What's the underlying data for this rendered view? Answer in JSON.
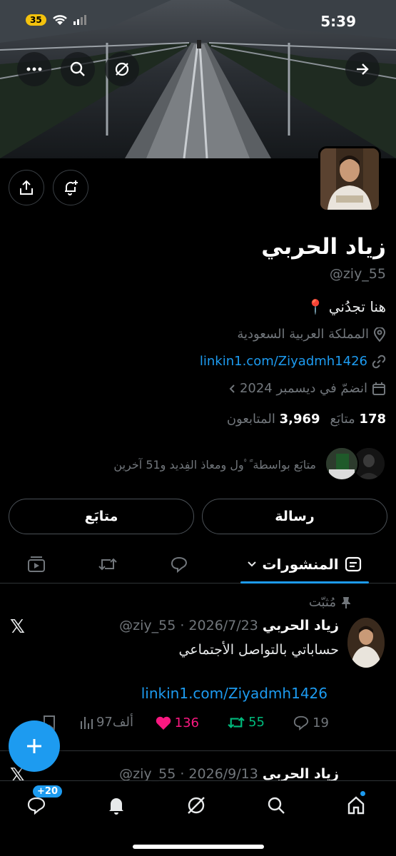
{
  "status_bar": {
    "time": "5:39",
    "battery": "35"
  },
  "profile": {
    "name": "زياد الحربي",
    "handle": "@ziy_55",
    "bio": "هنا تجدُني 📍",
    "location": "المملكة العربية السعودية",
    "link": "linkin1.com/Ziyadmh1426",
    "joined": "انضمّ في ديسمبر 2024",
    "following_count": "178",
    "following_label": "متابَع",
    "followers_count": "3,969",
    "followers_label": "المتابعون",
    "followed_by": "متابَع بواسطة ًﾟول ومعاذ الفِديد و51 آخرين"
  },
  "buttons": {
    "message": "رسالة",
    "follow": "متابَع"
  },
  "tabs": {
    "posts": "المنشورات"
  },
  "pinned_post": {
    "pinned_label": "مُثبّت",
    "author": "زياد الحربي",
    "handle_date": "@ziy_55 · 2026/7/23",
    "text": "حساباتي بالتواصل الأجتماعي",
    "link": "linkin1.com/Ziyadmh1426",
    "replies": "19",
    "reposts": "55",
    "likes": "136",
    "views": "97ألف"
  },
  "next_post": {
    "author": "زياد الحربي",
    "handle_date": "@ziy_55 · 2026/9/13"
  },
  "bottom_nav": {
    "messages_badge": "+20"
  },
  "colors": {
    "accent": "#1d9bf0",
    "like": "#f91880",
    "repost": "#00ba7c"
  }
}
